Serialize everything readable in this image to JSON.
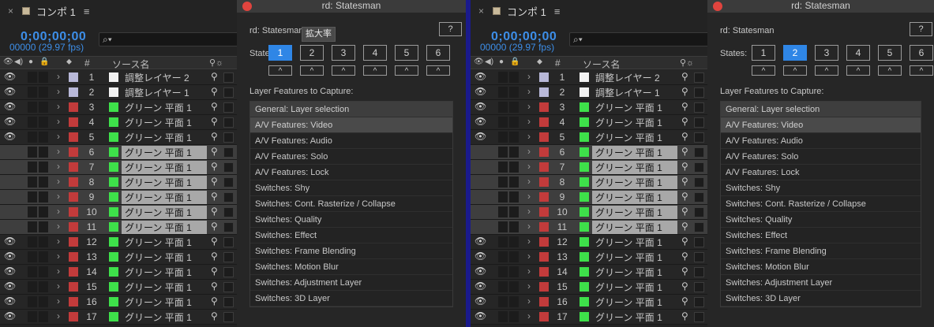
{
  "panels": [
    {
      "ae": {
        "tab_close": "×",
        "tab_name": "コンポ 1",
        "tab_menu": "≡",
        "timecode": "0;00;00;00",
        "fps": "00000 (29.97 fps)",
        "search_icon": "⌕▾",
        "header": {
          "num": "#",
          "source": "ソース名"
        },
        "rows": [
          {
            "num": "1",
            "name": "調整レイヤー 2",
            "label": "#b8b8d8",
            "swatch": "#f2f2f2",
            "selected": false
          },
          {
            "num": "2",
            "name": "調整レイヤー 1",
            "label": "#b8b8d8",
            "swatch": "#f2f2f2",
            "selected": false
          },
          {
            "num": "3",
            "name": "グリーン 平面 1",
            "label": "#c23b3b",
            "swatch": "#3ee04a",
            "selected": false
          },
          {
            "num": "4",
            "name": "グリーン 平面 1",
            "label": "#c23b3b",
            "swatch": "#3ee04a",
            "selected": false
          },
          {
            "num": "5",
            "name": "グリーン 平面 1",
            "label": "#c23b3b",
            "swatch": "#3ee04a",
            "selected": false
          },
          {
            "num": "6",
            "name": "グリーン 平面 1",
            "label": "#c23b3b",
            "swatch": "#3ee04a",
            "selected": true
          },
          {
            "num": "7",
            "name": "グリーン 平面 1",
            "label": "#c23b3b",
            "swatch": "#3ee04a",
            "selected": true
          },
          {
            "num": "8",
            "name": "グリーン 平面 1",
            "label": "#c23b3b",
            "swatch": "#3ee04a",
            "selected": true
          },
          {
            "num": "9",
            "name": "グリーン 平面 1",
            "label": "#c23b3b",
            "swatch": "#3ee04a",
            "selected": true
          },
          {
            "num": "10",
            "name": "グリーン 平面 1",
            "label": "#c23b3b",
            "swatch": "#3ee04a",
            "selected": true
          },
          {
            "num": "11",
            "name": "グリーン 平面 1",
            "label": "#c23b3b",
            "swatch": "#3ee04a",
            "selected": true
          },
          {
            "num": "12",
            "name": "グリーン 平面 1",
            "label": "#c23b3b",
            "swatch": "#3ee04a",
            "selected": false
          },
          {
            "num": "13",
            "name": "グリーン 平面 1",
            "label": "#c23b3b",
            "swatch": "#3ee04a",
            "selected": false
          },
          {
            "num": "14",
            "name": "グリーン 平面 1",
            "label": "#c23b3b",
            "swatch": "#3ee04a",
            "selected": false
          },
          {
            "num": "15",
            "name": "グリーン 平面 1",
            "label": "#c23b3b",
            "swatch": "#3ee04a",
            "selected": false
          },
          {
            "num": "16",
            "name": "グリーン 平面 1",
            "label": "#c23b3b",
            "swatch": "#3ee04a",
            "selected": false
          },
          {
            "num": "17",
            "name": "グリーン 平面 1",
            "label": "#c23b3b",
            "swatch": "#3ee04a",
            "selected": false
          }
        ]
      },
      "rd": {
        "title": "rd: Statesman",
        "name": "rd: Statesman",
        "help": "?",
        "tooltip": "拡大率",
        "states_label": "States:",
        "states": [
          "1",
          "2",
          "3",
          "4",
          "5",
          "6"
        ],
        "active_state": 0,
        "up": "^",
        "features_label": "Layer Features to Capture:",
        "features": [
          "General: Layer selection",
          "A/V Features: Video",
          "A/V Features: Audio",
          "A/V Features: Solo",
          "A/V Features: Lock",
          "Switches: Shy",
          "Switches: Cont. Rasterize / Collapse",
          "Switches: Quality",
          "Switches: Effect",
          "Switches: Frame Blending",
          "Switches: Motion Blur",
          "Switches: Adjustment Layer",
          "Switches: 3D Layer"
        ],
        "highlighted": 1
      }
    },
    {
      "ae": {
        "tab_close": "×",
        "tab_name": "コンポ 1",
        "tab_menu": "≡",
        "timecode": "0;00;00;00",
        "fps": "00000 (29.97 fps)",
        "search_icon": "⌕▾",
        "header": {
          "num": "#",
          "source": "ソース名"
        },
        "rows": [
          {
            "num": "1",
            "name": "調整レイヤー 2",
            "label": "#b8b8d8",
            "swatch": "#f2f2f2",
            "selected": false
          },
          {
            "num": "2",
            "name": "調整レイヤー 1",
            "label": "#b8b8d8",
            "swatch": "#f2f2f2",
            "selected": false
          },
          {
            "num": "3",
            "name": "グリーン 平面 1",
            "label": "#c23b3b",
            "swatch": "#3ee04a",
            "selected": false
          },
          {
            "num": "4",
            "name": "グリーン 平面 1",
            "label": "#c23b3b",
            "swatch": "#3ee04a",
            "selected": false
          },
          {
            "num": "5",
            "name": "グリーン 平面 1",
            "label": "#c23b3b",
            "swatch": "#3ee04a",
            "selected": false
          },
          {
            "num": "6",
            "name": "グリーン 平面 1",
            "label": "#c23b3b",
            "swatch": "#3ee04a",
            "selected": true
          },
          {
            "num": "7",
            "name": "グリーン 平面 1",
            "label": "#c23b3b",
            "swatch": "#3ee04a",
            "selected": true
          },
          {
            "num": "8",
            "name": "グリーン 平面 1",
            "label": "#c23b3b",
            "swatch": "#3ee04a",
            "selected": true
          },
          {
            "num": "9",
            "name": "グリーン 平面 1",
            "label": "#c23b3b",
            "swatch": "#3ee04a",
            "selected": true
          },
          {
            "num": "10",
            "name": "グリーン 平面 1",
            "label": "#c23b3b",
            "swatch": "#3ee04a",
            "selected": true
          },
          {
            "num": "11",
            "name": "グリーン 平面 1",
            "label": "#c23b3b",
            "swatch": "#3ee04a",
            "selected": true
          },
          {
            "num": "12",
            "name": "グリーン 平面 1",
            "label": "#c23b3b",
            "swatch": "#3ee04a",
            "selected": false
          },
          {
            "num": "13",
            "name": "グリーン 平面 1",
            "label": "#c23b3b",
            "swatch": "#3ee04a",
            "selected": false
          },
          {
            "num": "14",
            "name": "グリーン 平面 1",
            "label": "#c23b3b",
            "swatch": "#3ee04a",
            "selected": false
          },
          {
            "num": "15",
            "name": "グリーン 平面 1",
            "label": "#c23b3b",
            "swatch": "#3ee04a",
            "selected": false
          },
          {
            "num": "16",
            "name": "グリーン 平面 1",
            "label": "#c23b3b",
            "swatch": "#3ee04a",
            "selected": false
          },
          {
            "num": "17",
            "name": "グリーン 平面 1",
            "label": "#c23b3b",
            "swatch": "#3ee04a",
            "selected": false
          }
        ]
      },
      "rd": {
        "title": "rd: Statesman",
        "name": "rd: Statesman",
        "help": "?",
        "tooltip": "",
        "states_label": "States:",
        "states": [
          "1",
          "2",
          "3",
          "4",
          "5",
          "6"
        ],
        "active_state": 1,
        "up": "^",
        "features_label": "Layer Features to Capture:",
        "features": [
          "General: Layer selection",
          "A/V Features: Video",
          "A/V Features: Audio",
          "A/V Features: Solo",
          "A/V Features: Lock",
          "Switches: Shy",
          "Switches: Cont. Rasterize / Collapse",
          "Switches: Quality",
          "Switches: Effect",
          "Switches: Frame Blending",
          "Switches: Motion Blur",
          "Switches: Adjustment Layer",
          "Switches: 3D Layer"
        ],
        "highlighted": 1
      }
    }
  ]
}
